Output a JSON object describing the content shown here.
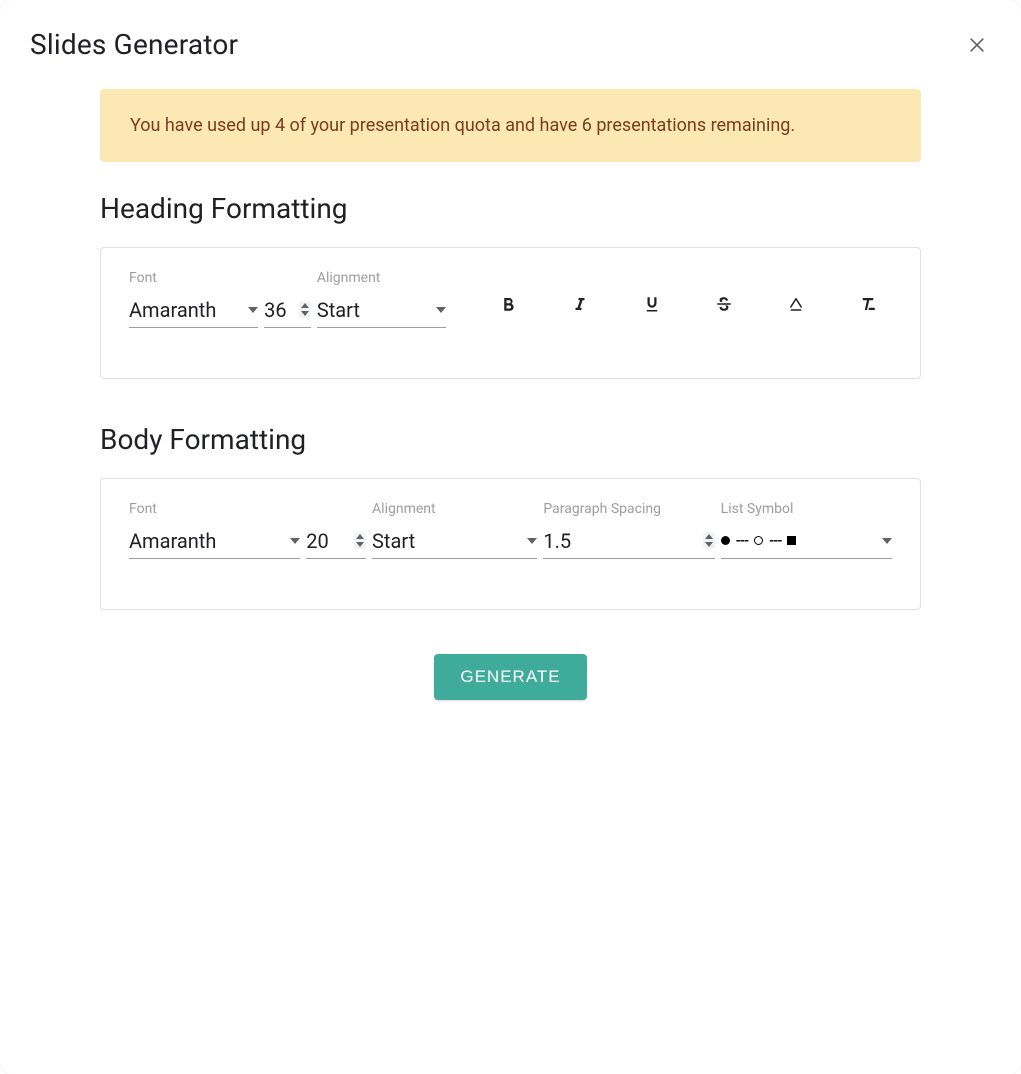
{
  "dialog": {
    "title": "Slides Generator"
  },
  "banner": {
    "text": "You have used up 4 of your presentation quota and have 6 presentations remaining."
  },
  "sections": {
    "heading": {
      "title": "Heading Formatting",
      "font_label": "Font",
      "font_value": "Amaranth",
      "size_value": "36",
      "align_label": "Alignment",
      "align_value": "Start"
    },
    "body": {
      "title": "Body Formatting",
      "font_label": "Font",
      "font_value": "Amaranth",
      "size_value": "20",
      "align_label": "Alignment",
      "align_value": "Start",
      "paragraph_label": "Paragraph Spacing",
      "paragraph_value": "1.5",
      "list_label": "List Symbol"
    }
  },
  "actions": {
    "generate_label": "GENERATE"
  }
}
